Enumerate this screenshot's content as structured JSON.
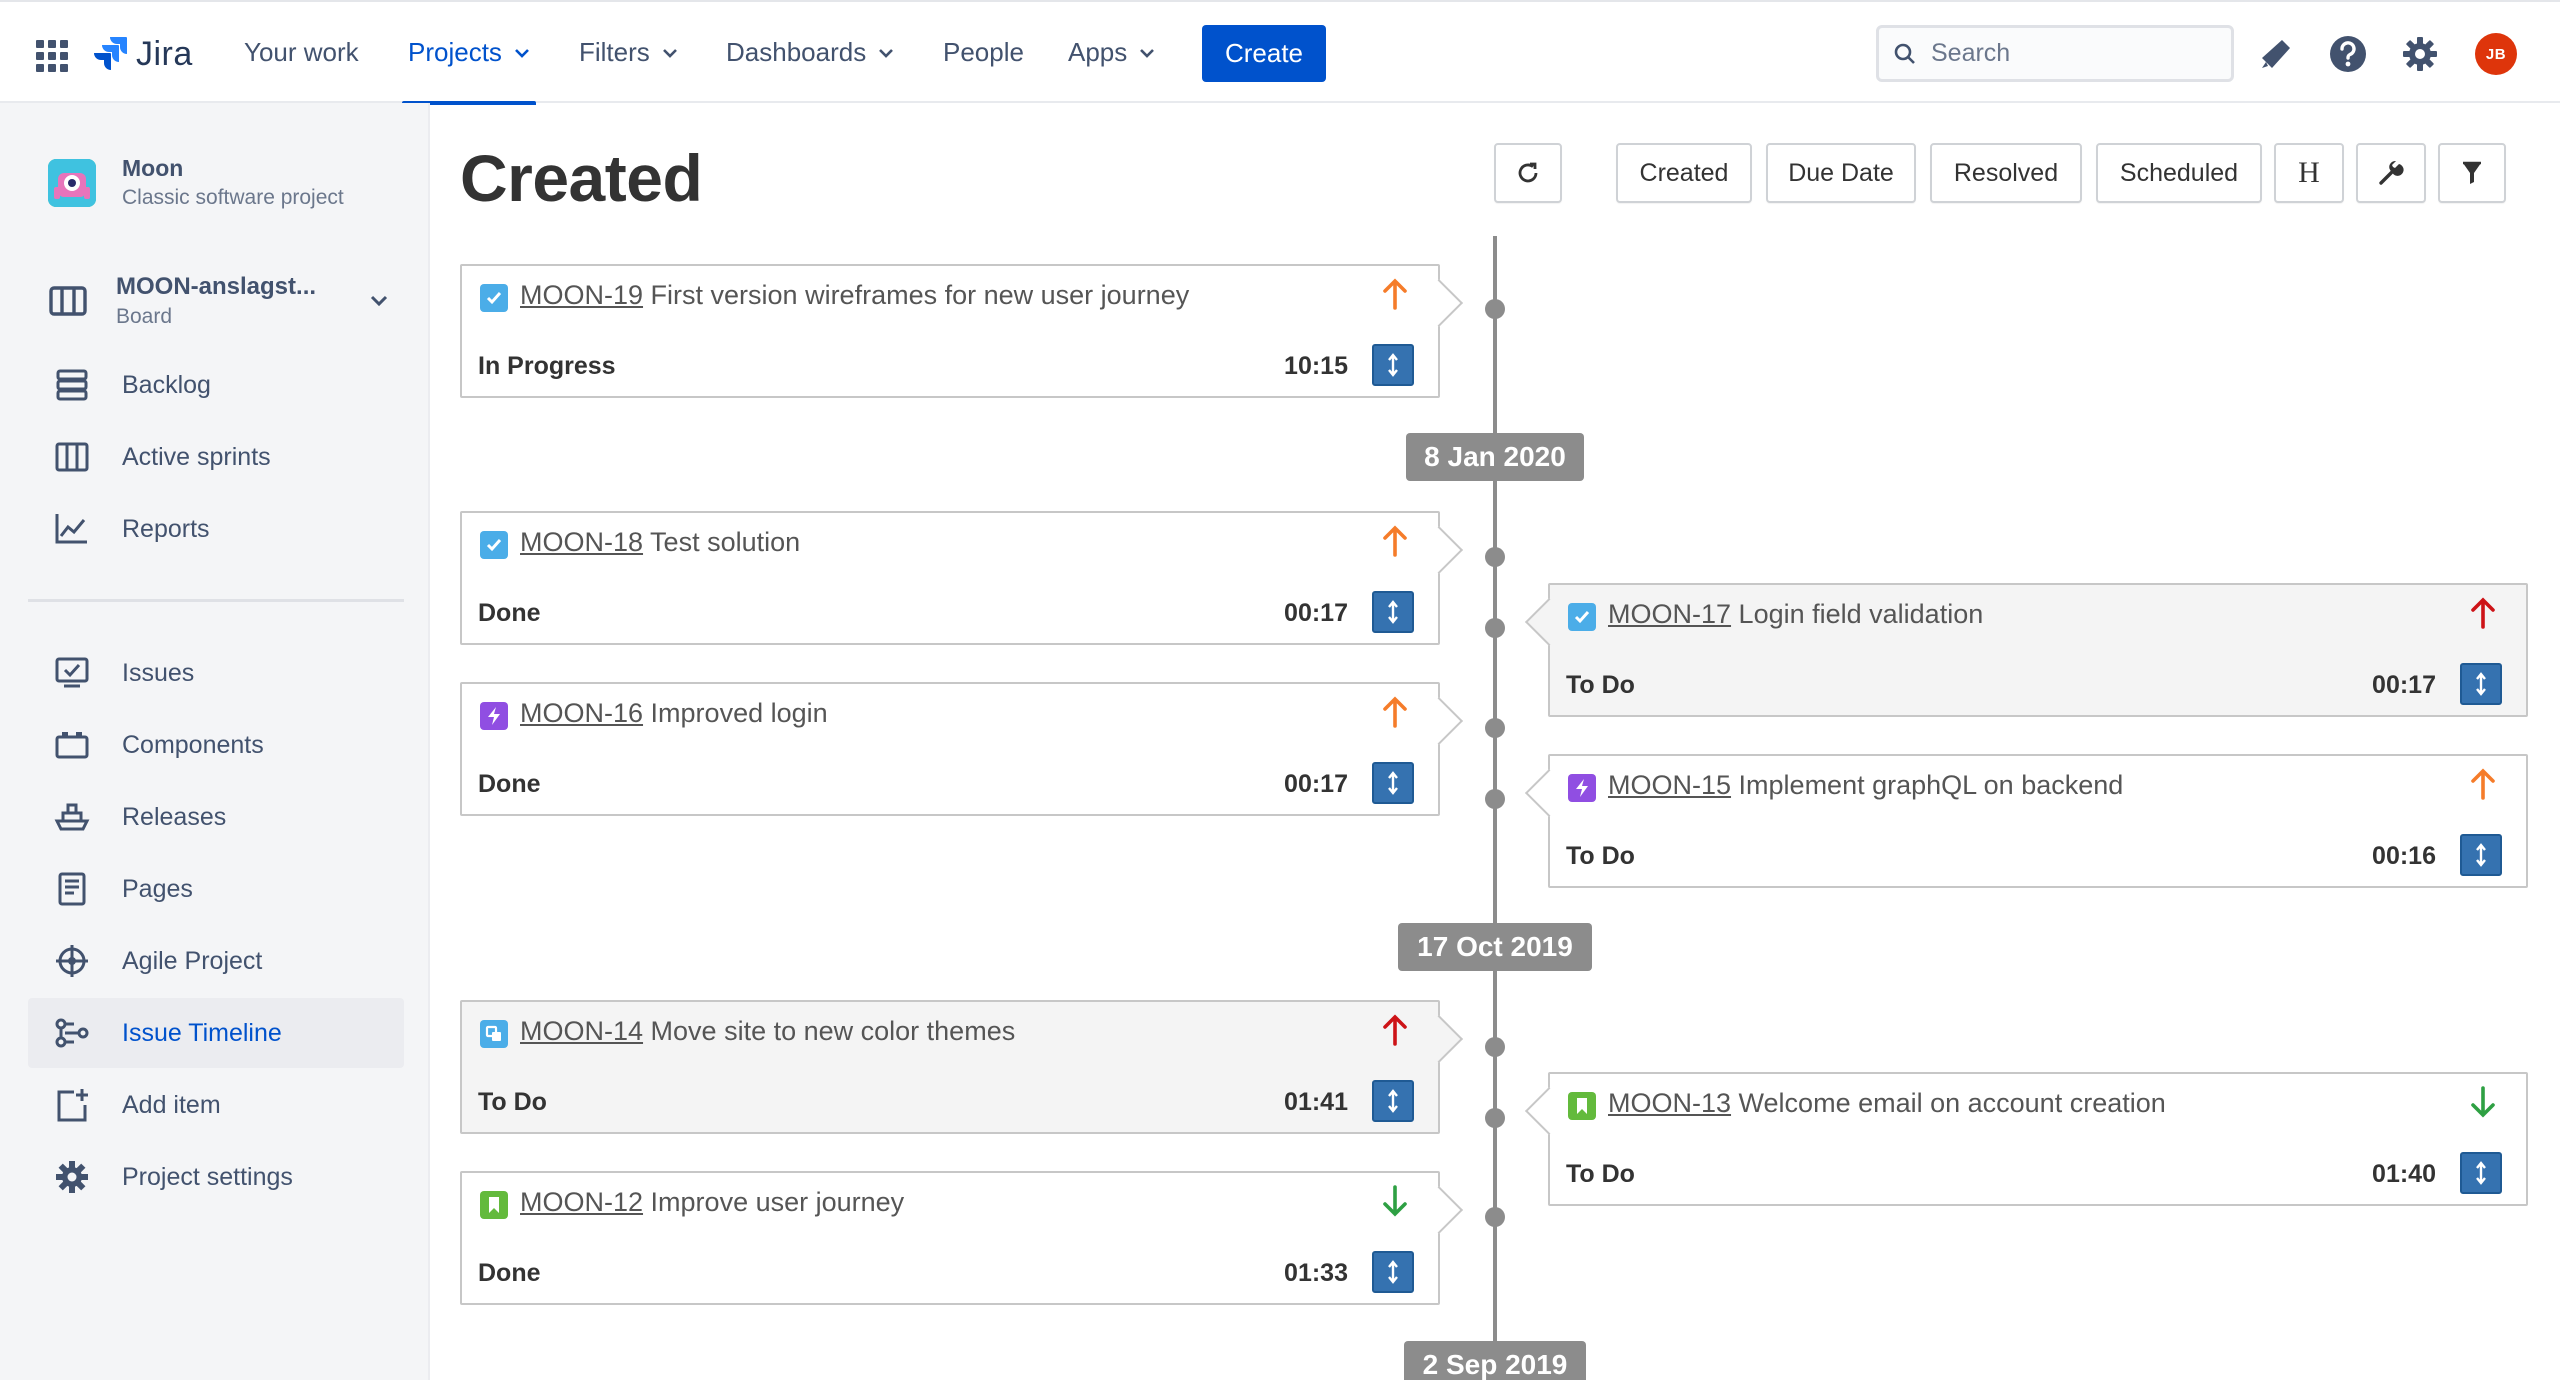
{
  "nav": {
    "logo_text": "Jira",
    "items": [
      {
        "label": "Your work"
      },
      {
        "label": "Projects"
      },
      {
        "label": "Filters"
      },
      {
        "label": "Dashboards"
      },
      {
        "label": "People"
      },
      {
        "label": "Apps"
      }
    ],
    "create_label": "Create",
    "search_placeholder": "Search",
    "avatar_initials": "JB"
  },
  "sidebar": {
    "project_name": "Moon",
    "project_type": "Classic software project",
    "board_name": "MOON-anslagst...",
    "board_type": "Board",
    "items": [
      {
        "label": "Backlog"
      },
      {
        "label": "Active sprints"
      },
      {
        "label": "Reports"
      },
      {
        "label": "Issues"
      },
      {
        "label": "Components"
      },
      {
        "label": "Releases"
      },
      {
        "label": "Pages"
      },
      {
        "label": "Agile Project"
      },
      {
        "label": "Issue Timeline"
      },
      {
        "label": "Add item"
      },
      {
        "label": "Project settings"
      }
    ]
  },
  "main": {
    "title": "Created",
    "toolbar": {
      "created": "Created",
      "due_date": "Due Date",
      "resolved": "Resolved",
      "scheduled": "Scheduled",
      "h": "H"
    },
    "dates": [
      "8 Jan 2020",
      "17 Oct 2019",
      "2 Sep 2019"
    ],
    "issues": [
      {
        "key": "MOON-19",
        "summary": "First version wireframes for new user journey",
        "status": "In Progress",
        "time": "10:15",
        "type": "task",
        "priority": "high"
      },
      {
        "key": "MOON-18",
        "summary": "Test solution",
        "status": "Done",
        "time": "00:17",
        "type": "task",
        "priority": "high"
      },
      {
        "key": "MOON-17",
        "summary": "Login field validation",
        "status": "To Do",
        "time": "00:17",
        "type": "task",
        "priority": "highest"
      },
      {
        "key": "MOON-16",
        "summary": "Improved login",
        "status": "Done",
        "time": "00:17",
        "type": "epic",
        "priority": "high"
      },
      {
        "key": "MOON-15",
        "summary": "Implement graphQL on backend",
        "status": "To Do",
        "time": "00:16",
        "type": "epic",
        "priority": "high"
      },
      {
        "key": "MOON-14",
        "summary": "Move site to new color themes",
        "status": "To Do",
        "time": "01:41",
        "type": "subtask",
        "priority": "highest"
      },
      {
        "key": "MOON-13",
        "summary": "Welcome email on account creation",
        "status": "To Do",
        "time": "01:40",
        "type": "story",
        "priority": "low"
      },
      {
        "key": "MOON-12",
        "summary": "Improve user journey",
        "status": "Done",
        "time": "01:33",
        "type": "story",
        "priority": "low"
      }
    ]
  },
  "colors": {
    "primary": "#0052cc",
    "priority_high": "#f57c2a",
    "priority_highest": "#cd1317",
    "priority_low": "#2ea043",
    "task": "#4bade8",
    "epic": "#904ee2",
    "story": "#63ba3c",
    "timeline_gray": "#8c8c8c"
  }
}
